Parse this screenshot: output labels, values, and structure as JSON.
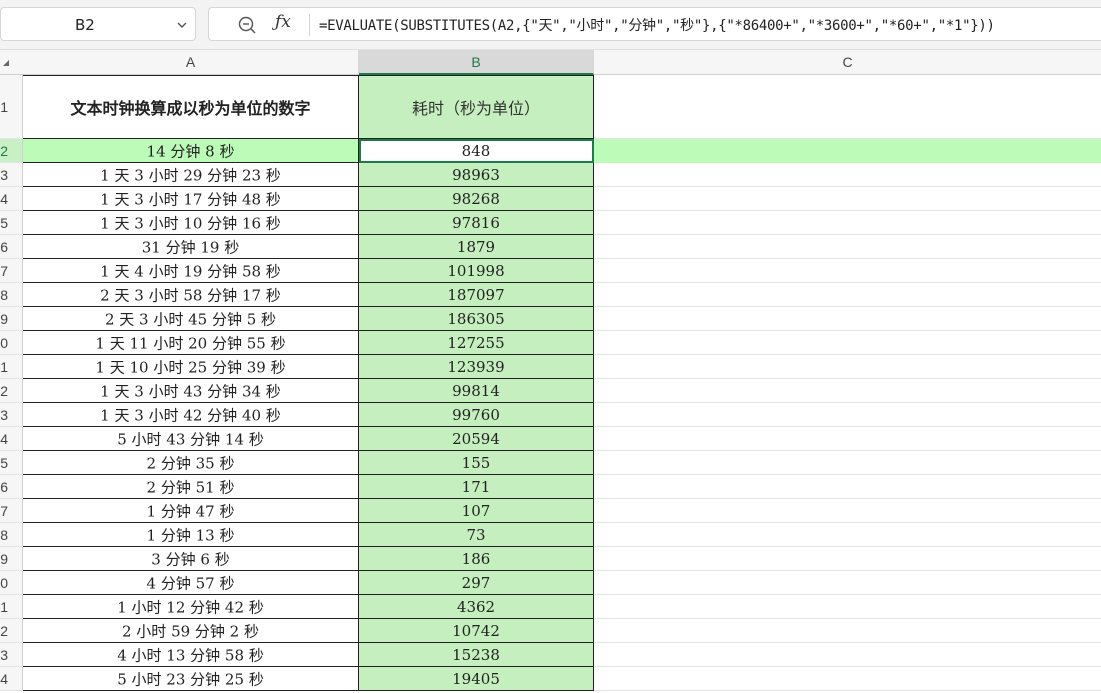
{
  "formula_bar": {
    "cell_ref": "B2",
    "formula": "=EVALUATE(SUBSTITUTES(A2,{\"天\",\"小时\",\"分钟\",\"秒\"},{\"*86400+\",\"*3600+\",\"*60+\",\"*1\"}))"
  },
  "columns": [
    "A",
    "B",
    "C"
  ],
  "header_row": {
    "row_label": "1",
    "a": "文本时钟换算成以秒为单位的数字",
    "b": "耗时（秒为单位）"
  },
  "rows": [
    {
      "n": "2",
      "a": "14 分钟 8 秒",
      "b": "848"
    },
    {
      "n": "3",
      "a": "1 天 3 小时 29 分钟 23 秒",
      "b": "98963"
    },
    {
      "n": "4",
      "a": "1 天 3 小时 17 分钟 48 秒",
      "b": "98268"
    },
    {
      "n": "5",
      "a": "1 天 3 小时 10 分钟 16 秒",
      "b": "97816"
    },
    {
      "n": "6",
      "a": "31 分钟 19 秒",
      "b": "1879"
    },
    {
      "n": "7",
      "a": "1 天 4 小时 19 分钟 58 秒",
      "b": "101998"
    },
    {
      "n": "8",
      "a": "2 天 3 小时 58 分钟 17 秒",
      "b": "187097"
    },
    {
      "n": "9",
      "a": "2 天 3 小时 45 分钟 5 秒",
      "b": "186305"
    },
    {
      "n": "0",
      "a": "1 天 11 小时 20 分钟 55 秒",
      "b": "127255"
    },
    {
      "n": "1",
      "a": "1 天 10 小时 25 分钟 39 秒",
      "b": "123939"
    },
    {
      "n": "2",
      "a": "1 天 3 小时 43 分钟 34 秒",
      "b": "99814"
    },
    {
      "n": "3",
      "a": "1 天 3 小时 42 分钟 40 秒",
      "b": "99760"
    },
    {
      "n": "4",
      "a": "5 小时 43 分钟 14 秒",
      "b": "20594"
    },
    {
      "n": "5",
      "a": "2 分钟 35 秒",
      "b": "155"
    },
    {
      "n": "6",
      "a": "2 分钟 51 秒",
      "b": "171"
    },
    {
      "n": "7",
      "a": "1 分钟 47 秒",
      "b": "107"
    },
    {
      "n": "8",
      "a": "1 分钟 13 秒",
      "b": "73"
    },
    {
      "n": "9",
      "a": "3 分钟 6 秒",
      "b": "186"
    },
    {
      "n": "20",
      "a": "4 分钟 57 秒",
      "b": "297"
    },
    {
      "n": "21",
      "a": "1 小时 12 分钟 42 秒",
      "b": "4362"
    },
    {
      "n": "22",
      "a": "2 小时 59 分钟 2 秒",
      "b": "10742"
    },
    {
      "n": "23",
      "a": "4 小时 13 分钟 58 秒",
      "b": "15238"
    },
    {
      "n": "24",
      "a": "5 小时 23 分钟 25 秒",
      "b": "19405"
    }
  ],
  "colors": {
    "selection_green": "#1d7a4a",
    "column_b_fill": "#c6efbf",
    "active_row_fill": "#bdfbb9"
  }
}
